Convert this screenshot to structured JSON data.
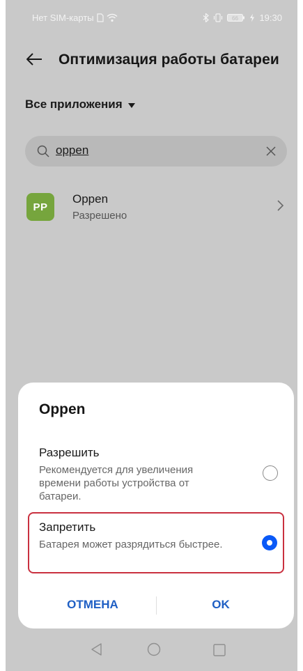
{
  "status_bar": {
    "carrier": "Нет SIM-карты",
    "battery_text": "66",
    "time": "19:30"
  },
  "header": {
    "title": "Оптимизация работы батареи",
    "back_icon": "arrow-left-icon"
  },
  "filter": {
    "label": "Все приложения"
  },
  "search": {
    "value": "oppen",
    "icon": "search-icon",
    "clear_icon": "close-icon"
  },
  "app": {
    "logo_text": "PP",
    "logo_color": "#76a53d",
    "name": "Oppen",
    "status": "Разрешено"
  },
  "dialog": {
    "title": "Oppen",
    "options": [
      {
        "title": "Разрешить",
        "description": "Рекомендуется для увеличения времени работы устройства от батареи.",
        "selected": false
      },
      {
        "title": "Запретить",
        "description": "Батарея может разрядиться быстрее.",
        "selected": true
      }
    ],
    "cancel_label": "ОТМЕНА",
    "ok_label": "OK",
    "accent_color": "#0a59f7",
    "highlight_color": "#c9303f"
  }
}
